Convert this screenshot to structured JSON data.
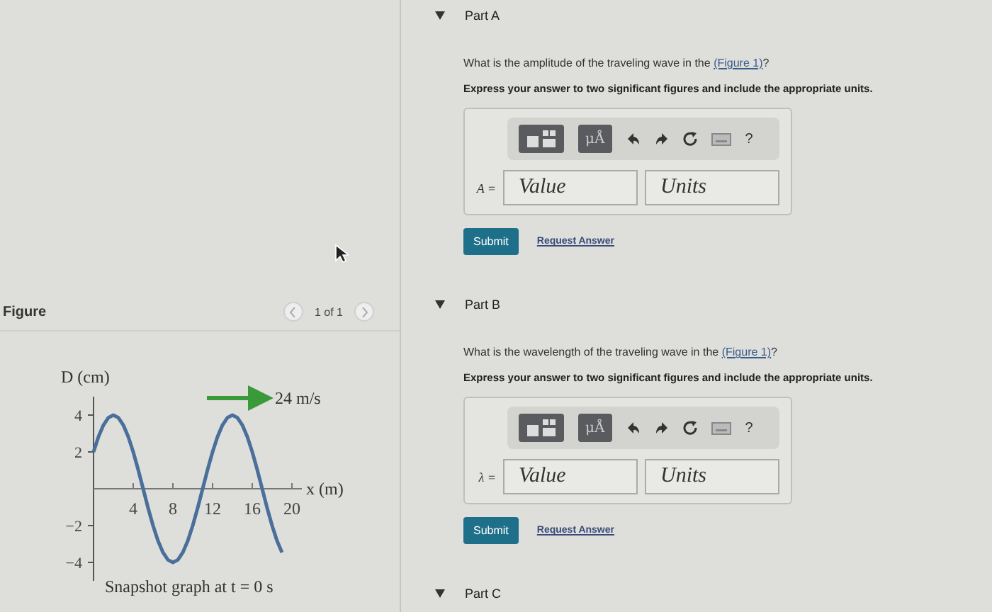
{
  "figure": {
    "title": "Figure",
    "pager": "1 of 1",
    "chart_data": {
      "type": "line",
      "title": "Snapshot graph at t = 0 s",
      "xlabel": "x (m)",
      "ylabel": "D (cm)",
      "x": [
        0,
        0.5,
        1,
        1.5,
        2,
        2.5,
        3,
        3.5,
        4,
        4.5,
        5,
        5.5,
        6,
        6.5,
        7,
        7.5,
        8,
        8.5,
        9,
        9.5,
        10,
        10.5,
        11,
        11.5,
        12,
        12.5,
        13,
        13.5,
        14,
        14.5,
        15,
        15.5,
        16,
        16.5,
        17,
        17.5,
        18,
        18.5,
        19
      ],
      "series": [
        {
          "color": "#4a6f9a",
          "values": [
            2,
            2.83,
            3.46,
            3.86,
            4,
            3.86,
            3.46,
            2.83,
            2,
            1.04,
            0,
            -1.04,
            -2,
            -2.83,
            -3.46,
            -3.86,
            -4,
            -3.86,
            -3.46,
            -2.83,
            -2,
            -1.04,
            0,
            1.04,
            2,
            2.83,
            3.46,
            3.86,
            4,
            3.86,
            3.46,
            2.83,
            2,
            1.04,
            0,
            -1.04,
            -2,
            -2.83,
            -3.46
          ]
        }
      ],
      "xticks": [
        4,
        8,
        12,
        16,
        20
      ],
      "yticks": [
        -4,
        -2,
        2,
        4
      ],
      "xlim": [
        0,
        21
      ],
      "ylim": [
        -5,
        5
      ],
      "annotations": [
        "24 m/s"
      ]
    }
  },
  "parts": [
    {
      "label": "Part A",
      "expanded": true,
      "question": "What is the amplitude of the traveling wave in the",
      "link": "(Figure 1)",
      "question_end": "?",
      "instruction": "Express your answer to two significant figures and include the appropriate units.",
      "units_tool": "μÅ",
      "help": "?",
      "variable": "A =",
      "value_placeholder": "Value",
      "units_placeholder": "Units",
      "submit": "Submit",
      "request": "Request Answer"
    },
    {
      "label": "Part B",
      "expanded": true,
      "question": "What is the wavelength of the traveling wave in the",
      "link": "(Figure 1)",
      "question_end": "?",
      "instruction": "Express your answer to two significant figures and include the appropriate units.",
      "units_tool": "μÅ",
      "help": "?",
      "variable": "λ =",
      "value_placeholder": "Value",
      "units_placeholder": "Units",
      "submit": "Submit",
      "request": "Request Answer"
    },
    {
      "label": "Part C",
      "expanded": true
    }
  ]
}
